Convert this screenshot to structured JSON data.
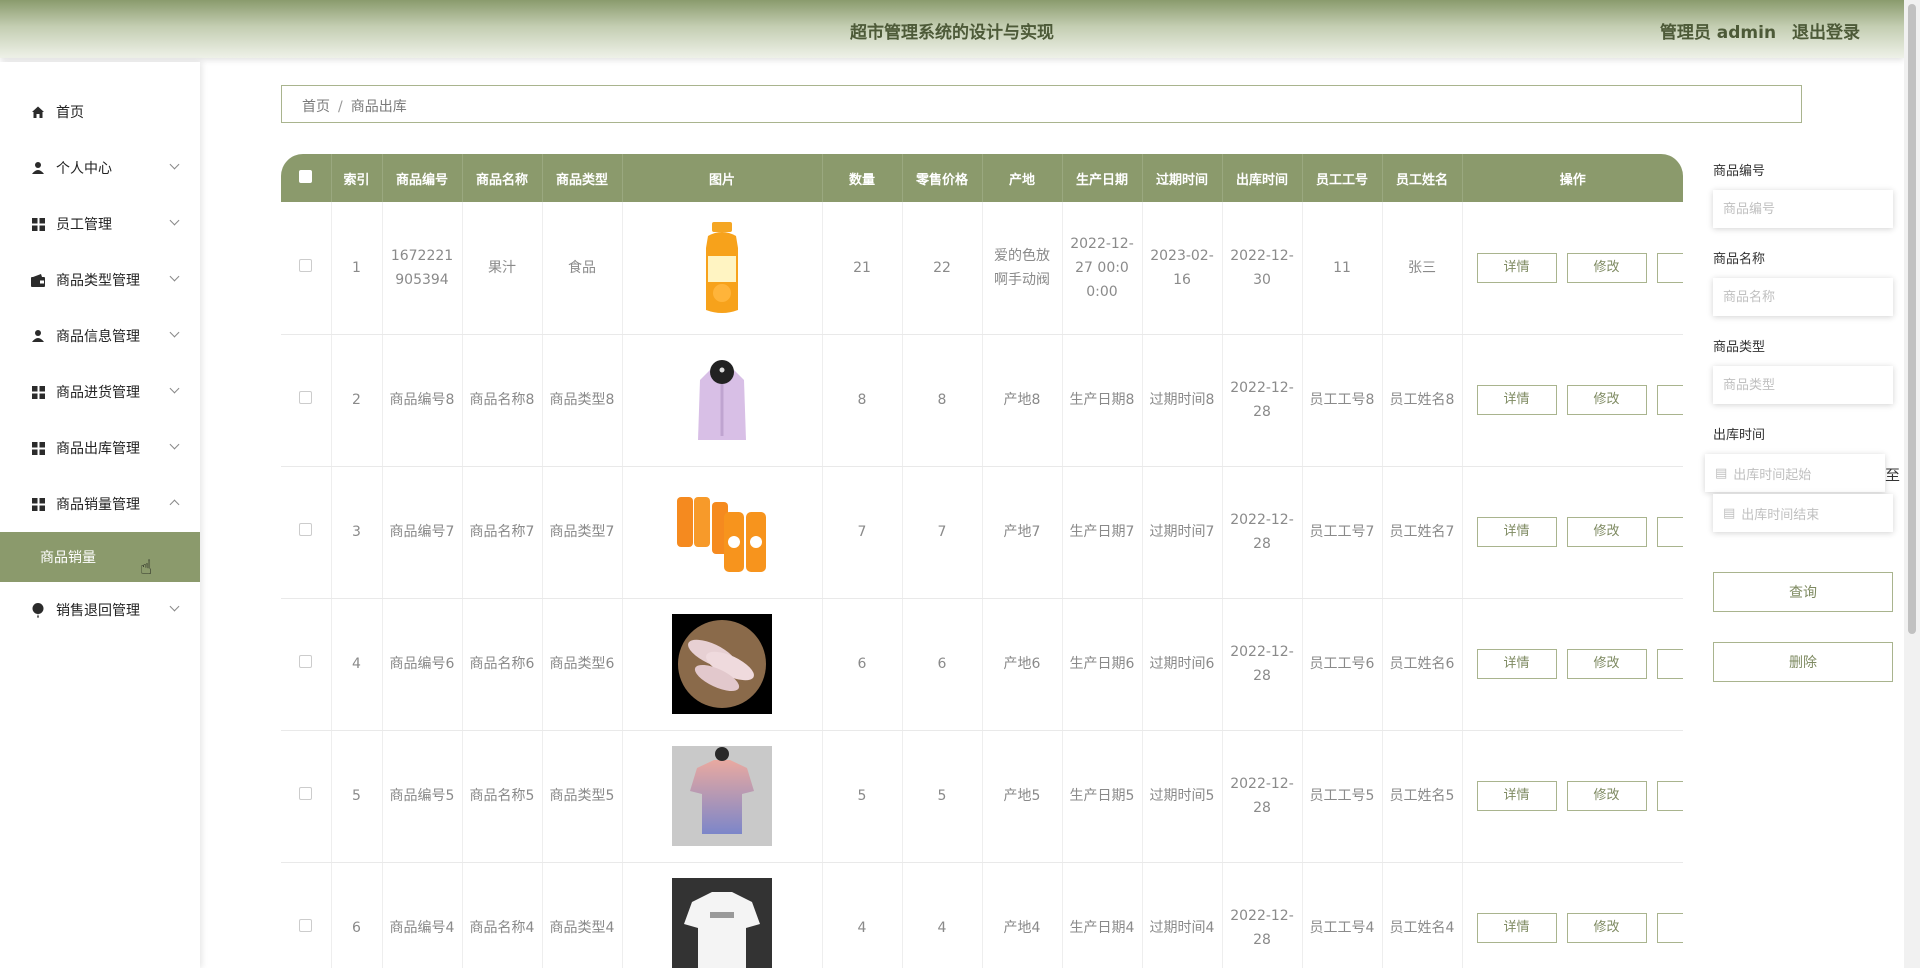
{
  "header": {
    "title": "超市管理系统的设计与实现",
    "user_label": "管理员 admin",
    "logout": "退出登录"
  },
  "sidebar": {
    "items": [
      {
        "label": "首页",
        "icon": "home-icon"
      },
      {
        "label": "个人中心",
        "icon": "user-icon"
      },
      {
        "label": "员工管理",
        "icon": "grid-icon"
      },
      {
        "label": "商品类型管理",
        "icon": "wallet-icon"
      },
      {
        "label": "商品信息管理",
        "icon": "user-icon"
      },
      {
        "label": "商品进货管理",
        "icon": "grid-icon"
      },
      {
        "label": "商品出库管理",
        "icon": "grid-icon"
      },
      {
        "label": "商品销量管理",
        "icon": "grid-icon"
      },
      {
        "label": "销售退回管理",
        "icon": "balloon-icon"
      }
    ],
    "active_sub": "商品销量"
  },
  "breadcrumb": {
    "home": "首页",
    "current": "商品出库"
  },
  "table": {
    "headers": [
      "索引",
      "商品编号",
      "商品名称",
      "商品类型",
      "图片",
      "数量",
      "零售价格",
      "产地",
      "生产日期",
      "过期时间",
      "出库时间",
      "员工工号",
      "员工姓名",
      "操作"
    ],
    "rows": [
      {
        "idx": "1",
        "code": "1672221905394",
        "name": "果汁",
        "type": "食品",
        "qty": "21",
        "price": "22",
        "origin": "爱的色放啊手动阀",
        "mfg": "2022-12-27 00:00:00",
        "exp": "2023-02-16",
        "out": "2022-12-30",
        "emp_no": "11",
        "emp_name": "张三",
        "pic": "orange-juice-bottle"
      },
      {
        "idx": "2",
        "code": "商品编号8",
        "name": "商品名称8",
        "type": "商品类型8",
        "qty": "8",
        "price": "8",
        "origin": "产地8",
        "mfg": "生产日期8",
        "exp": "过期时间8",
        "out": "2022-12-28",
        "emp_no": "员工工号8",
        "emp_name": "员工姓名8",
        "pic": "purple-vest"
      },
      {
        "idx": "3",
        "code": "商品编号7",
        "name": "商品名称7",
        "type": "商品类型7",
        "qty": "7",
        "price": "7",
        "origin": "产地7",
        "mfg": "生产日期7",
        "exp": "过期时间7",
        "out": "2022-12-28",
        "emp_no": "员工工号7",
        "emp_name": "员工姓名7",
        "pic": "juice-multipack"
      },
      {
        "idx": "4",
        "code": "商品编号6",
        "name": "商品名称6",
        "type": "商品类型6",
        "qty": "6",
        "price": "6",
        "origin": "产地6",
        "mfg": "生产日期6",
        "exp": "过期时间6",
        "out": "2022-12-28",
        "emp_no": "员工工号6",
        "emp_name": "员工姓名6",
        "pic": "fish-fillets"
      },
      {
        "idx": "5",
        "code": "商品编号5",
        "name": "商品名称5",
        "type": "商品类型5",
        "qty": "5",
        "price": "5",
        "origin": "产地5",
        "mfg": "生产日期5",
        "exp": "过期时间5",
        "out": "2022-12-28",
        "emp_no": "员工工号5",
        "emp_name": "员工姓名5",
        "pic": "gradient-tshirt"
      },
      {
        "idx": "6",
        "code": "商品编号4",
        "name": "商品名称4",
        "type": "商品类型4",
        "qty": "4",
        "price": "4",
        "origin": "产地4",
        "mfg": "生产日期4",
        "exp": "过期时间4",
        "out": "2022-12-28",
        "emp_no": "员工工号4",
        "emp_name": "员工姓名4",
        "pic": "white-tshirt"
      }
    ],
    "ops": {
      "detail": "详情",
      "edit": "修改"
    }
  },
  "filter": {
    "code_label": "商品编号",
    "code_placeholder": "商品编号",
    "name_label": "商品名称",
    "name_placeholder": "商品名称",
    "type_label": "商品类型",
    "type_placeholder": "商品类型",
    "time_label": "出库时间",
    "time_start": "出库时间起始",
    "time_sep": "至",
    "time_end": "出库时间结束",
    "query": "查询",
    "delete": "删除"
  },
  "colors": {
    "accent": "#8b9a6c",
    "border": "#a9b48e"
  }
}
